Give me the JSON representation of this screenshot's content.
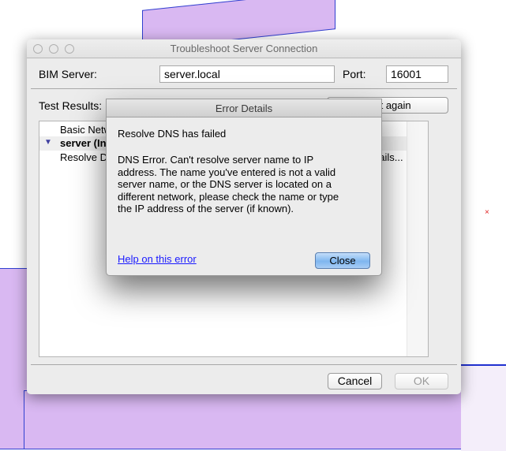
{
  "window": {
    "title": "Troubleshoot Server Connection",
    "server_label": "BIM Server:",
    "server_value": "server.local",
    "port_label": "Port:",
    "port_value": "16001",
    "test_results_label": "Test Results:",
    "test_again_button": "Test again",
    "results": [
      {
        "label": "Basic Network",
        "bold": false
      },
      {
        "label": "server (Internet)",
        "bold": true
      },
      {
        "label": "Resolve DNS",
        "bold": false,
        "action": "Details..."
      }
    ],
    "cancel_button": "Cancel",
    "ok_button": "OK"
  },
  "error_dialog": {
    "title": "Error Details",
    "heading": "Resolve DNS has failed",
    "message": "DNS Error. Can't resolve server name to IP address. The name you've entered is not a valid server name, or the DNS server is located on a different network, please check the name or type the IP address of the server (if known).",
    "help_link": "Help on this error",
    "close_button": "Close"
  },
  "colors": {
    "link": "#1a1aff",
    "default_button": "#7fb6ef",
    "cad_fill": "#d9b8f2"
  }
}
